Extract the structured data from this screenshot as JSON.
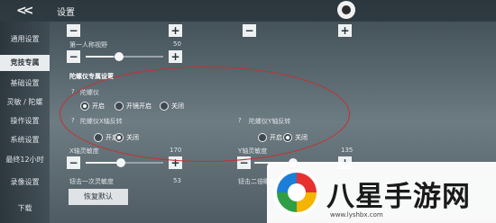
{
  "topbar": {
    "back_icon": "double-chevron-left",
    "title": "设置",
    "avatar_icon": "avatar"
  },
  "sidebar": {
    "items": [
      {
        "label": "通用设置",
        "active": false
      },
      {
        "label": "竞技专属",
        "active": true
      },
      {
        "label": "基础设置",
        "active": false
      },
      {
        "label": "灵敏 / 陀螺",
        "active": false
      },
      {
        "label": "操作设置",
        "active": false
      },
      {
        "label": "系统设置",
        "active": false
      },
      {
        "label": "最终12小时",
        "active": false
      },
      {
        "label": "录像设置",
        "active": false
      },
      {
        "label": "下载",
        "active": false
      }
    ]
  },
  "sensitivity": {
    "fpp": {
      "label": "第一人称视野",
      "value": "50",
      "level_percent": 38
    },
    "x_axis": {
      "label": "X轴灵敏度",
      "value": "170",
      "level_percent": 40
    },
    "y_axis": {
      "label": "Y轴灵敏度",
      "value": "135",
      "level_percent": 50
    },
    "fire_left": {
      "label": "钮击一次灵敏度",
      "value": "53"
    },
    "fire_right": {
      "label": "钮击二倍瞄准"
    },
    "minus": "−",
    "plus": "+"
  },
  "gyro": {
    "section_title": "陀螺仪专属设置",
    "q_mark": "?",
    "gyro_label": "陀螺仪",
    "gyro_options": [
      "开启",
      "开镜开启",
      "关闭"
    ],
    "gyro_selected": 0,
    "x_invert_label": "陀螺仪X轴反转",
    "x_invert_options": [
      "开启",
      "关闭"
    ],
    "x_invert_selected": 1,
    "y_invert_label": "陀螺仪Y轴反转",
    "y_invert_options": [
      "开启",
      "关闭"
    ],
    "y_invert_selected": 1
  },
  "reset_label": "恢复默认",
  "watermark": {
    "text": "八星手游网",
    "url": "www.lyshbx.com"
  },
  "colors": {
    "highlight_circle": "#c3322f"
  }
}
